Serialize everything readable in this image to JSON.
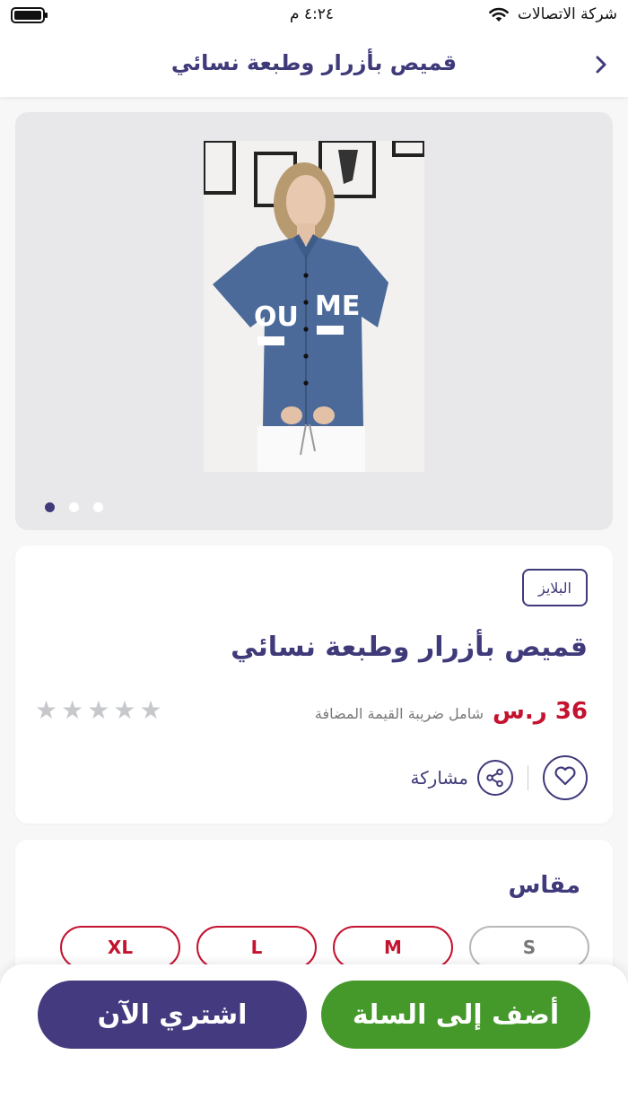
{
  "status_bar": {
    "carrier": "شركة الاتصالات",
    "time": "٤:٢٤ م"
  },
  "header": {
    "title": "قميص بأزرار وطبعة نسائي",
    "back_icon": "chevron-right-icon"
  },
  "gallery": {
    "image_alt": "product photo: blue short-sleeve shirt with YOU ME print",
    "image_count": 3,
    "active_index": 0
  },
  "product": {
    "category": "البلايز",
    "title": "قميص بأزرار وطبعة نسائي",
    "price": "36 ر.س",
    "vat_note": "شامل ضريبة القيمة المضافة",
    "rating": 0,
    "rating_max": 5,
    "share_label": "مشاركة"
  },
  "sizes": {
    "heading": "مقاس",
    "options": [
      {
        "label": "S",
        "available": false
      },
      {
        "label": "M",
        "available": true
      },
      {
        "label": "L",
        "available": true
      },
      {
        "label": "XL",
        "available": true
      }
    ]
  },
  "actions": {
    "add_to_cart": "أضف إلى السلة",
    "buy_now": "اشتري الآن"
  },
  "colors": {
    "brand_purple": "#3f3a7a",
    "price_red": "#c4122f",
    "cart_green": "#45982a",
    "buy_purple": "#443a7f"
  }
}
